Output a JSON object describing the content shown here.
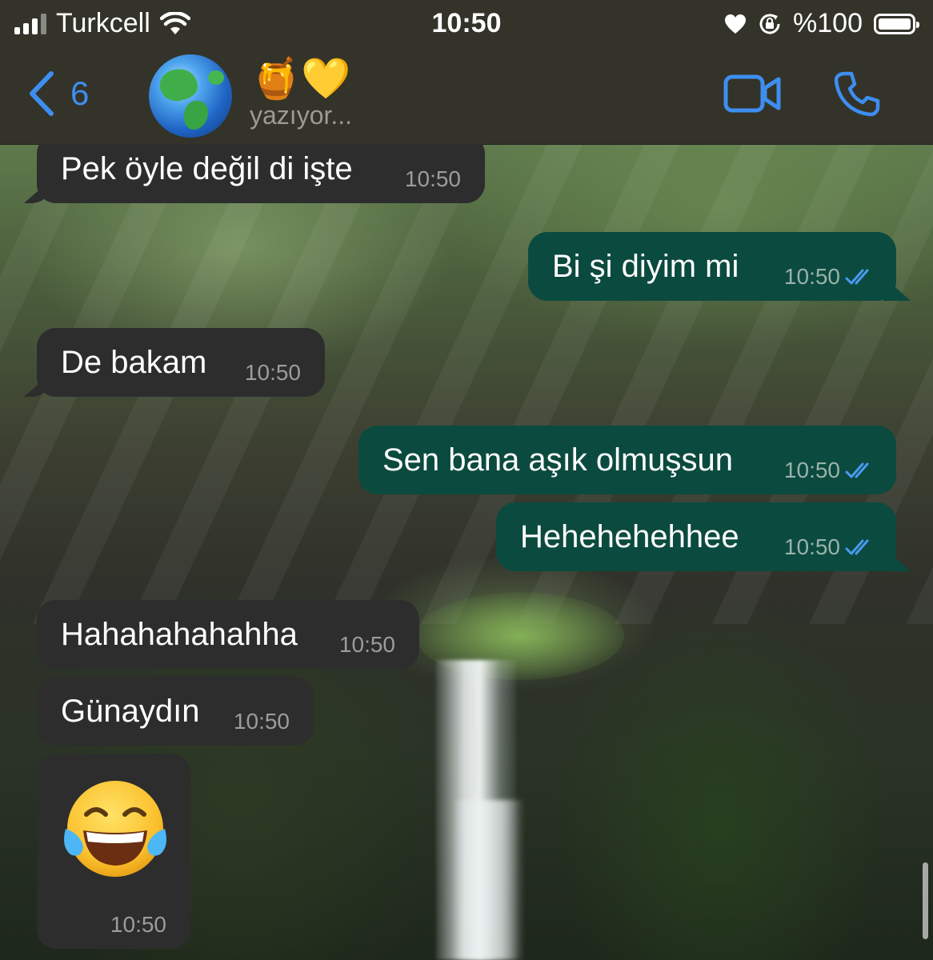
{
  "status_bar": {
    "carrier": "Turkcell",
    "time": "10:50",
    "battery": "%100",
    "battery_level": 1.0
  },
  "nav": {
    "back_count": "6",
    "contact_name": "🍯💛",
    "status": "yazıyor...",
    "icons": [
      "back-chevron-icon",
      "avatar-globe",
      "video-call-icon",
      "phone-icon"
    ],
    "accent_color": "#3d8ef0"
  },
  "messages": [
    {
      "direction": "incoming",
      "text": "Pek öyle değil di işte",
      "time": "10:50",
      "tail": true
    },
    {
      "direction": "outgoing",
      "text": "Bi şi diyim mi",
      "time": "10:50",
      "read": true,
      "tail": true
    },
    {
      "direction": "incoming",
      "text": "De bakam",
      "time": "10:50",
      "tail": true
    },
    {
      "direction": "outgoing",
      "text": "Sen bana aşık olmuşsun",
      "time": "10:50",
      "read": true,
      "tail": false
    },
    {
      "direction": "outgoing",
      "text": "Hehehehehhee",
      "time": "10:50",
      "read": true,
      "tail": true
    },
    {
      "direction": "incoming",
      "text": "Hahahahahahha",
      "time": "10:50",
      "tail": false
    },
    {
      "direction": "incoming",
      "text": "Günaydın",
      "time": "10:50",
      "tail": false
    },
    {
      "direction": "incoming",
      "emoji": "😂",
      "time": "10:50",
      "tail": false
    }
  ],
  "colors": {
    "incoming_bubble": "#2d2d2e",
    "outgoing_bubble": "#0b4a3f",
    "read_ticks": "#4a9af0"
  }
}
